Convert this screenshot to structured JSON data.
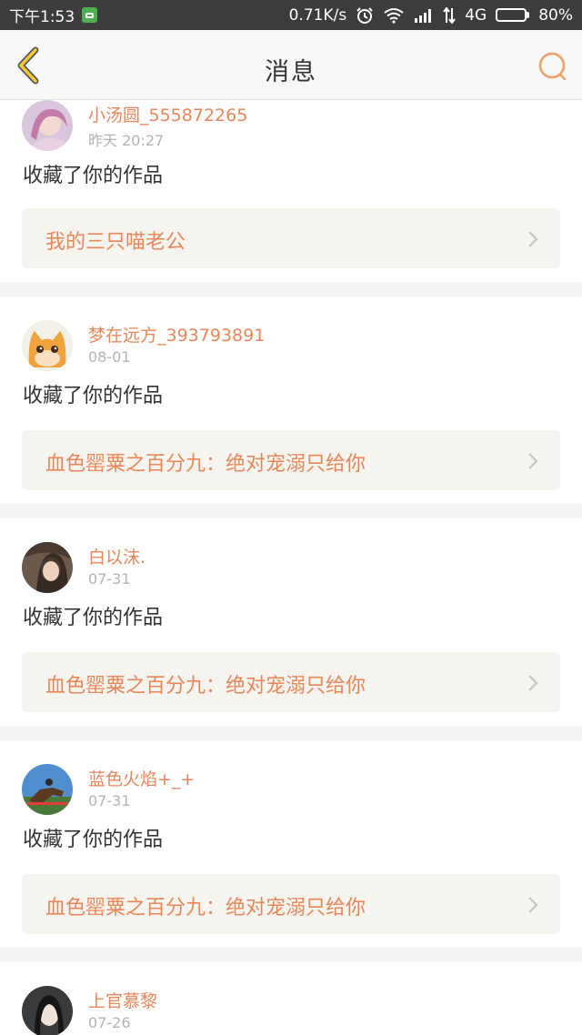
{
  "status_bar": {
    "time": "下午1:53",
    "speed": "0.71K/s",
    "network": "4G",
    "battery": "80%",
    "battery_level": 0.8
  },
  "header": {
    "title": "消息",
    "back_icon": "back-chevron-icon",
    "search_icon": "search-icon",
    "accent_color": "#e8875a"
  },
  "messages": [
    {
      "username": "小汤圆_555872265",
      "time": "昨天 20:27",
      "action": "收藏了你的作品",
      "work_title": "我的三只喵老公"
    },
    {
      "username": "梦在远方_393793891",
      "time": "08-01",
      "action": "收藏了你的作品",
      "work_title": "血色罂粟之百分九：绝对宠溺只给你"
    },
    {
      "username": "白以沫.",
      "time": "07-31",
      "action": "收藏了你的作品",
      "work_title": "血色罂粟之百分九：绝对宠溺只给你"
    },
    {
      "username": "蓝色火焰+_+",
      "time": "07-31",
      "action": "收藏了你的作品",
      "work_title": "血色罂粟之百分九：绝对宠溺只给你"
    },
    {
      "username": "上官慕黎",
      "time": "07-26"
    }
  ]
}
